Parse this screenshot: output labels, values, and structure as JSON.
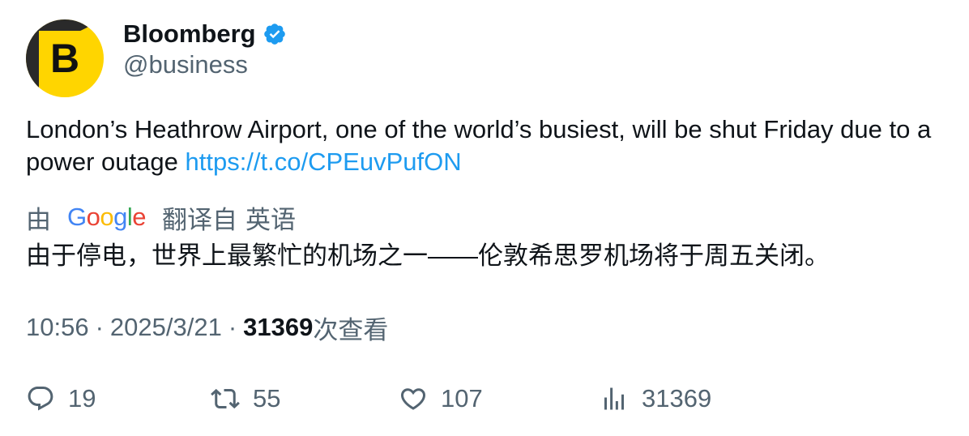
{
  "author": {
    "display_name": "Bloomberg",
    "handle": "@business",
    "avatar_letter": "B",
    "verified": true,
    "avatar_color": "#ffd500"
  },
  "tweet": {
    "text": "London’s Heathrow Airport, one of the world’s busiest, will be shut Friday due to a power outage ",
    "link": "https://t.co/CPEuvPufON",
    "link_color": "#1d9bf0"
  },
  "translation": {
    "prefix": "由",
    "provider": "Google",
    "suffix_from": "翻译自",
    "language": "英语",
    "text": "由于停电，世界上最繁忙的机场之一——伦敦希思罗机场将于周五关闭。"
  },
  "meta": {
    "time": "10:56",
    "date": "2025/3/21",
    "views_count": "31369",
    "views_label": "次查看",
    "separator": "·"
  },
  "actions": {
    "reply": {
      "icon": "reply-icon",
      "count": "19"
    },
    "retweet": {
      "icon": "retweet-icon",
      "count": "55"
    },
    "like": {
      "icon": "heart-icon",
      "count": "107"
    },
    "views": {
      "icon": "analytics-icon",
      "count": "31369"
    }
  },
  "colors": {
    "text_primary": "#0f1419",
    "text_secondary": "#536471",
    "verified_blue": "#1d9bf0"
  }
}
